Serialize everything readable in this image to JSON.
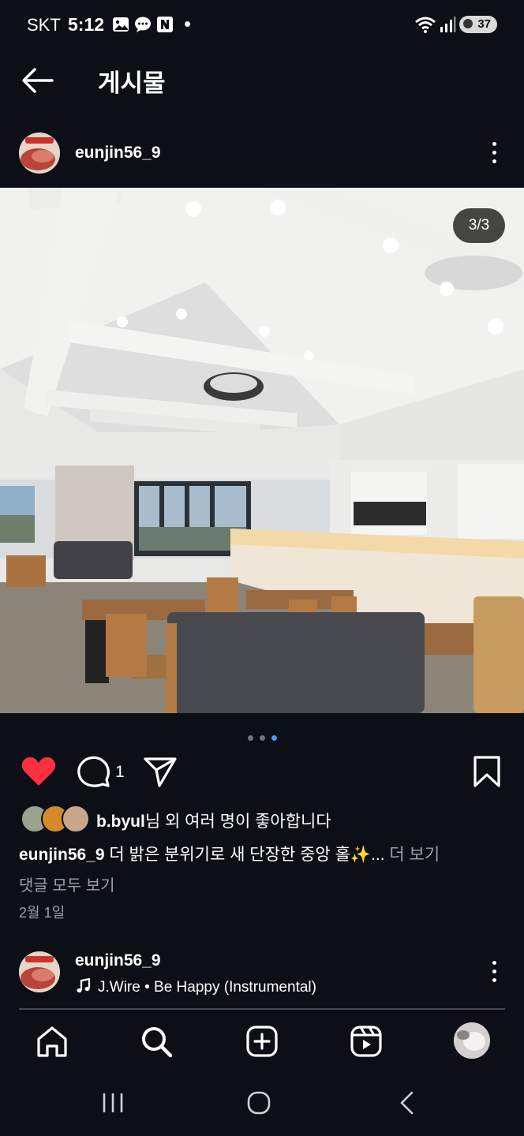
{
  "status_bar": {
    "carrier": "SKT",
    "time": "5:12",
    "battery": "37",
    "icons": [
      "gallery-icon",
      "chat-icon",
      "naver-icon",
      "wifi-icon",
      "signal-icon"
    ]
  },
  "header": {
    "title": "게시물",
    "back_icon": "arrow-left-icon"
  },
  "post": {
    "username": "eunjin56_9",
    "image_counter": "3/3",
    "carousel": {
      "total": 3,
      "active": 3
    },
    "comment_count": "1",
    "liked_by": {
      "name": "b.byul",
      "suffix": "님 외 여러 명이 좋아합니다"
    },
    "caption": {
      "username": "eunjin56_9",
      "text": " 더 밝은 분위기로 새 단장한 중앙 홀✨...",
      "more": " 더 보기"
    },
    "view_all_comments": "댓글 모두 보기",
    "date": "2월 1일"
  },
  "next_post": {
    "username": "eunjin56_9",
    "music": "J.Wire • Be Happy (Instrumental)"
  },
  "bottom_nav": [
    "home-icon",
    "search-icon",
    "create-icon",
    "reels-icon",
    "profile-avatar"
  ],
  "colors": {
    "background": "#0c1016",
    "like_red": "#ff3040",
    "carousel_active": "#3d9aff"
  }
}
